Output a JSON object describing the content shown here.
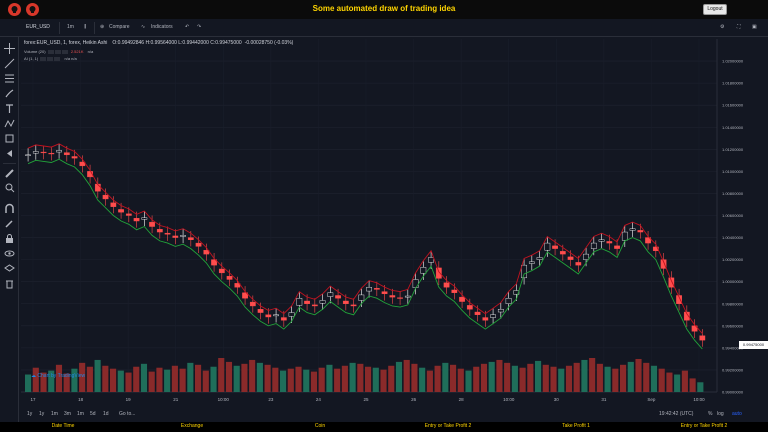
{
  "app": {
    "title": "Some automated draw of trading idea",
    "logout_label": "Logout"
  },
  "toolbar": {
    "symbol": "EUR_USD",
    "interval": "1m",
    "compare_label": "Compare",
    "indicators_label": "Indicators"
  },
  "legend": {
    "symbol_line": "forex:EUR_USD, 1, forex, Heikin Ashi",
    "ohlc": "O:0.99492846  H:0.99564000  L:0.99442000  C:0.99475000",
    "change": "-0.00028750 (-0.03%)",
    "volume_label": "Volume (20)",
    "volume_value": "2.521K",
    "volume_extra": "n/a",
    "ai_label": "AI (1, 1)",
    "ai_values": "n/a  n/a"
  },
  "watermark": "Chart by TradingView",
  "price_axis": {
    "ticks": [
      "1.02000000",
      "1.01800000",
      "1.01600000",
      "1.01400000",
      "1.01200000",
      "1.01000000",
      "1.00800000",
      "1.00600000",
      "1.00400000",
      "1.00200000",
      "1.00000000",
      "0.99800000",
      "0.99600000",
      "0.99400000",
      "0.99200000",
      "0.99000000"
    ],
    "current_price": "0.99475000"
  },
  "time_axis": {
    "labels": [
      "17",
      "18",
      "19",
      "21",
      "10:00",
      "23",
      "24",
      "25",
      "26",
      "28",
      "10:00",
      "30",
      "31",
      "Sep",
      "10:00"
    ]
  },
  "range_buttons": [
    "1y",
    "1y",
    "1m",
    "3m",
    "1m",
    "5d",
    "1d",
    "Go to..."
  ],
  "status": {
    "clock": "19:42:42 (UTC)",
    "percent": "%",
    "log": "log",
    "auto": "auto"
  },
  "footer": {
    "columns": [
      "Date Time",
      "Exchange",
      "Coin",
      "Entry or Take Profit 2",
      "Take Profit 1",
      "Entry or Take Profit 2"
    ]
  },
  "chart_data": {
    "type": "candlestick",
    "ylim": [
      0.99,
      1.022
    ],
    "series": [
      {
        "name": "price",
        "values": [
          1.0115,
          1.0118,
          1.0117,
          1.0116,
          1.0119,
          1.0115,
          1.0112,
          1.0105,
          1.0095,
          1.0082,
          1.0075,
          1.0068,
          1.0063,
          1.006,
          1.0055,
          1.0058,
          1.005,
          1.0045,
          1.0043,
          1.004,
          1.0042,
          1.0038,
          1.0032,
          1.0025,
          1.0015,
          1.0008,
          1.0002,
          0.9995,
          0.9985,
          0.9978,
          0.9972,
          0.9968,
          0.997,
          0.9965,
          0.9972,
          0.9985,
          0.998,
          0.9978,
          0.9983,
          0.999,
          0.9985,
          0.998,
          0.9978,
          0.9988,
          0.9995,
          0.9993,
          0.9989,
          0.9986,
          0.9985,
          0.9987,
          1.0002,
          1.0013,
          1.0022,
          1.0003,
          0.9995,
          0.999,
          0.9982,
          0.9975,
          0.997,
          0.9965,
          0.997,
          0.9975,
          0.9985,
          0.9992,
          1.0015,
          1.0018,
          1.0022,
          1.0035,
          1.003,
          1.0025,
          1.002,
          1.0015,
          1.0025,
          1.0035,
          1.0038,
          1.0035,
          1.003,
          1.0045,
          1.0048,
          1.0045,
          1.0035,
          1.0028,
          1.0012,
          0.9995,
          0.998,
          0.9965,
          0.9955,
          0.9947
        ]
      }
    ],
    "volume": [
      18,
      25,
      20,
      22,
      28,
      19,
      24,
      30,
      26,
      33,
      27,
      24,
      22,
      20,
      26,
      29,
      21,
      25,
      23,
      27,
      24,
      30,
      28,
      22,
      26,
      35,
      31,
      27,
      29,
      33,
      30,
      28,
      25,
      22,
      24,
      26,
      23,
      21,
      25,
      28,
      24,
      27,
      30,
      29,
      26,
      25,
      23,
      27,
      31,
      33,
      29,
      25,
      22,
      27,
      30,
      28,
      24,
      22,
      26,
      29,
      31,
      33,
      30,
      27,
      25,
      29,
      32,
      28,
      26,
      24,
      27,
      30,
      33,
      35,
      29,
      26,
      24,
      28,
      31,
      34,
      30,
      27,
      24,
      20,
      18,
      22,
      14,
      10
    ],
    "colors": {
      "up": "#ffffff",
      "down": "#ff4d4d",
      "ma_red": "#c1121f",
      "ma_green": "#22a33a",
      "vol_up": "#1f6e5a",
      "vol_down": "#8a2a2a"
    }
  }
}
